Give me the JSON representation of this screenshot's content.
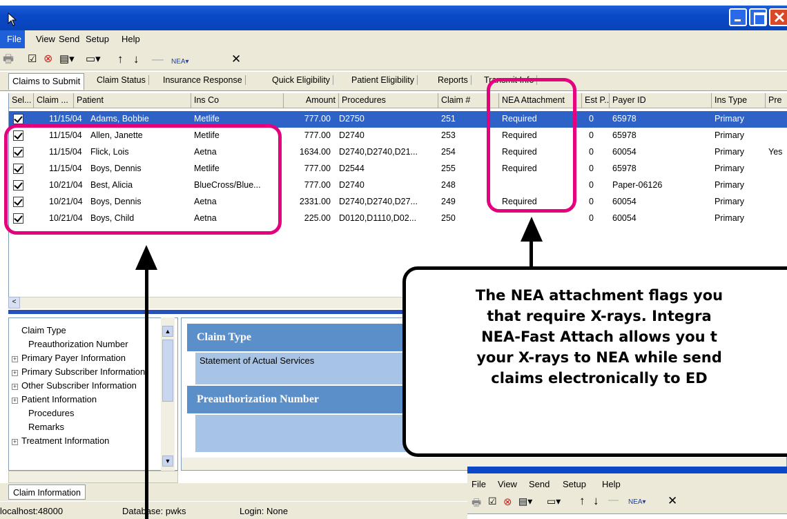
{
  "menu": {
    "file": "File",
    "view": "View",
    "send": "Send",
    "setup": "Setup",
    "help": "Help"
  },
  "tabs": [
    {
      "label": "Claims to Submit"
    },
    {
      "label": "Claim Status"
    },
    {
      "label": "Insurance Response"
    },
    {
      "label": "Quick Eligibility"
    },
    {
      "label": "Patient Eligibility"
    },
    {
      "label": "Reports"
    },
    {
      "label": "Transmit Info"
    }
  ],
  "grid": {
    "columns": [
      "Sel...",
      "Claim ...",
      "Patient",
      "Ins Co",
      "Amount",
      "Procedures",
      "Claim #",
      "NEA Attachment",
      "Est P...",
      "Payer ID",
      "Ins Type",
      "Pre"
    ],
    "rows": [
      {
        "date": "11/15/04",
        "patient": "Adams, Bobbie",
        "insco": "Metlife",
        "amount": "777.00",
        "procedures": "D2750",
        "claim": "251",
        "nea": "Required",
        "estp": "0",
        "payer": "65978",
        "instype": "Primary",
        "pre": ""
      },
      {
        "date": "11/15/04",
        "patient": "Allen, Janette",
        "insco": "Metlife",
        "amount": "777.00",
        "procedures": "D2740",
        "claim": "253",
        "nea": "Required",
        "estp": "0",
        "payer": "65978",
        "instype": "Primary",
        "pre": ""
      },
      {
        "date": "11/15/04",
        "patient": "Flick, Lois",
        "insco": "Aetna",
        "amount": "1634.00",
        "procedures": "D2740,D2740,D21...",
        "claim": "254",
        "nea": "Required",
        "estp": "0",
        "payer": "60054",
        "instype": "Primary",
        "pre": "Yes"
      },
      {
        "date": "11/15/04",
        "patient": "Boys, Dennis",
        "insco": "Metlife",
        "amount": "777.00",
        "procedures": "D2544",
        "claim": "255",
        "nea": "Required",
        "estp": "0",
        "payer": "65978",
        "instype": "Primary",
        "pre": ""
      },
      {
        "date": "10/21/04",
        "patient": "Best, Alicia",
        "insco": "BlueCross/Blue...",
        "amount": "777.00",
        "procedures": "D2740",
        "claim": "248",
        "nea": "",
        "estp": "0",
        "payer": "Paper-06126",
        "instype": "Primary",
        "pre": ""
      },
      {
        "date": "10/21/04",
        "patient": "Boys, Dennis",
        "insco": "Aetna",
        "amount": "2331.00",
        "procedures": "D2740,D2740,D27...",
        "claim": "249",
        "nea": "Required",
        "estp": "0",
        "payer": "60054",
        "instype": "Primary",
        "pre": ""
      },
      {
        "date": "10/21/04",
        "patient": "Boys, Child",
        "insco": "Aetna",
        "amount": "225.00",
        "procedures": "D0120,D1110,D02...",
        "claim": "250",
        "nea": "",
        "estp": "0",
        "payer": "60054",
        "instype": "Primary",
        "pre": ""
      }
    ]
  },
  "tree": {
    "items": [
      {
        "label": "Claim Type",
        "expandable": false
      },
      {
        "label": "Preauthorization Number",
        "expandable": false
      },
      {
        "label": "Primary Payer Information",
        "expandable": true
      },
      {
        "label": "Primary Subscriber Information",
        "expandable": true
      },
      {
        "label": "Other Subscriber Information",
        "expandable": true
      },
      {
        "label": "Patient Information",
        "expandable": true
      },
      {
        "label": "Procedures",
        "expandable": false
      },
      {
        "label": "Remarks",
        "expandable": false
      },
      {
        "label": "Treatment Information",
        "expandable": true
      }
    ]
  },
  "detail": {
    "claim_type_title": "Claim Type",
    "claim_type_value": "Statement of Actual Services",
    "preauth_title": "Preauthorization Number"
  },
  "bottom_tab": "Claim Information",
  "status": {
    "host": "localhost:48000",
    "database": "Database: pwks",
    "login": "Login: None"
  },
  "callout": "The NEA attachment flags you\nthat require X-rays. Integra\nNEA-Fast Attach allows you t\nyour X-rays to NEA while send\nclaims electronically to ED",
  "colors": {
    "highlight": "#e5007d",
    "selection": "#2f62c7",
    "titlebar": "#0a48c8"
  }
}
